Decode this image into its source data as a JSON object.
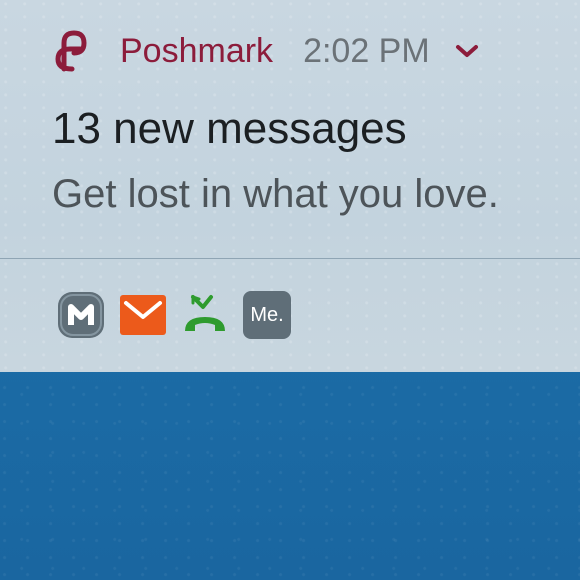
{
  "notification": {
    "app_name": "Poshmark",
    "time": "2:02 PM",
    "title": "13 new messages",
    "subtitle": "Get lost in what you love."
  },
  "status_icons": [
    {
      "name": "m-app-icon"
    },
    {
      "name": "email-icon"
    },
    {
      "name": "missed-call-icon"
    },
    {
      "name": "me-app-icon",
      "label": "Me."
    }
  ],
  "colors": {
    "brand": "#8c1c3b",
    "email_orange": "#ec5a1b",
    "call_green": "#2e9b2e",
    "icon_gray": "#5f6e78"
  }
}
